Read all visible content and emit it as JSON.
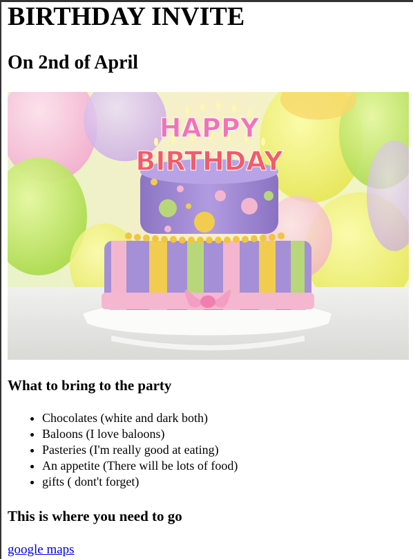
{
  "page": {
    "title": "BIRTHDAY INVITE",
    "date_heading": "On 2nd of April"
  },
  "image": {
    "cake_top_text": "HAPPY",
    "cake_bottom_text": "BIRTHDAY"
  },
  "bring_section": {
    "heading": "What to bring to the party",
    "items": [
      "Chocolates (white and dark both)",
      "Baloons (I love baloons)",
      "Pasteries (I'm really good at eating)",
      "An appetite (There will be lots of food)",
      "gifts ( dont't forget)"
    ]
  },
  "location_section": {
    "heading": "This is where you need to go",
    "link_text": "google maps"
  },
  "colors": {
    "link": "#0000ee",
    "text": "#000000",
    "cake_purple": "#a58fd6",
    "cake_pink": "#f4b6cf",
    "cake_yellow": "#f2cc4f",
    "cake_green": "#b7d77a"
  }
}
